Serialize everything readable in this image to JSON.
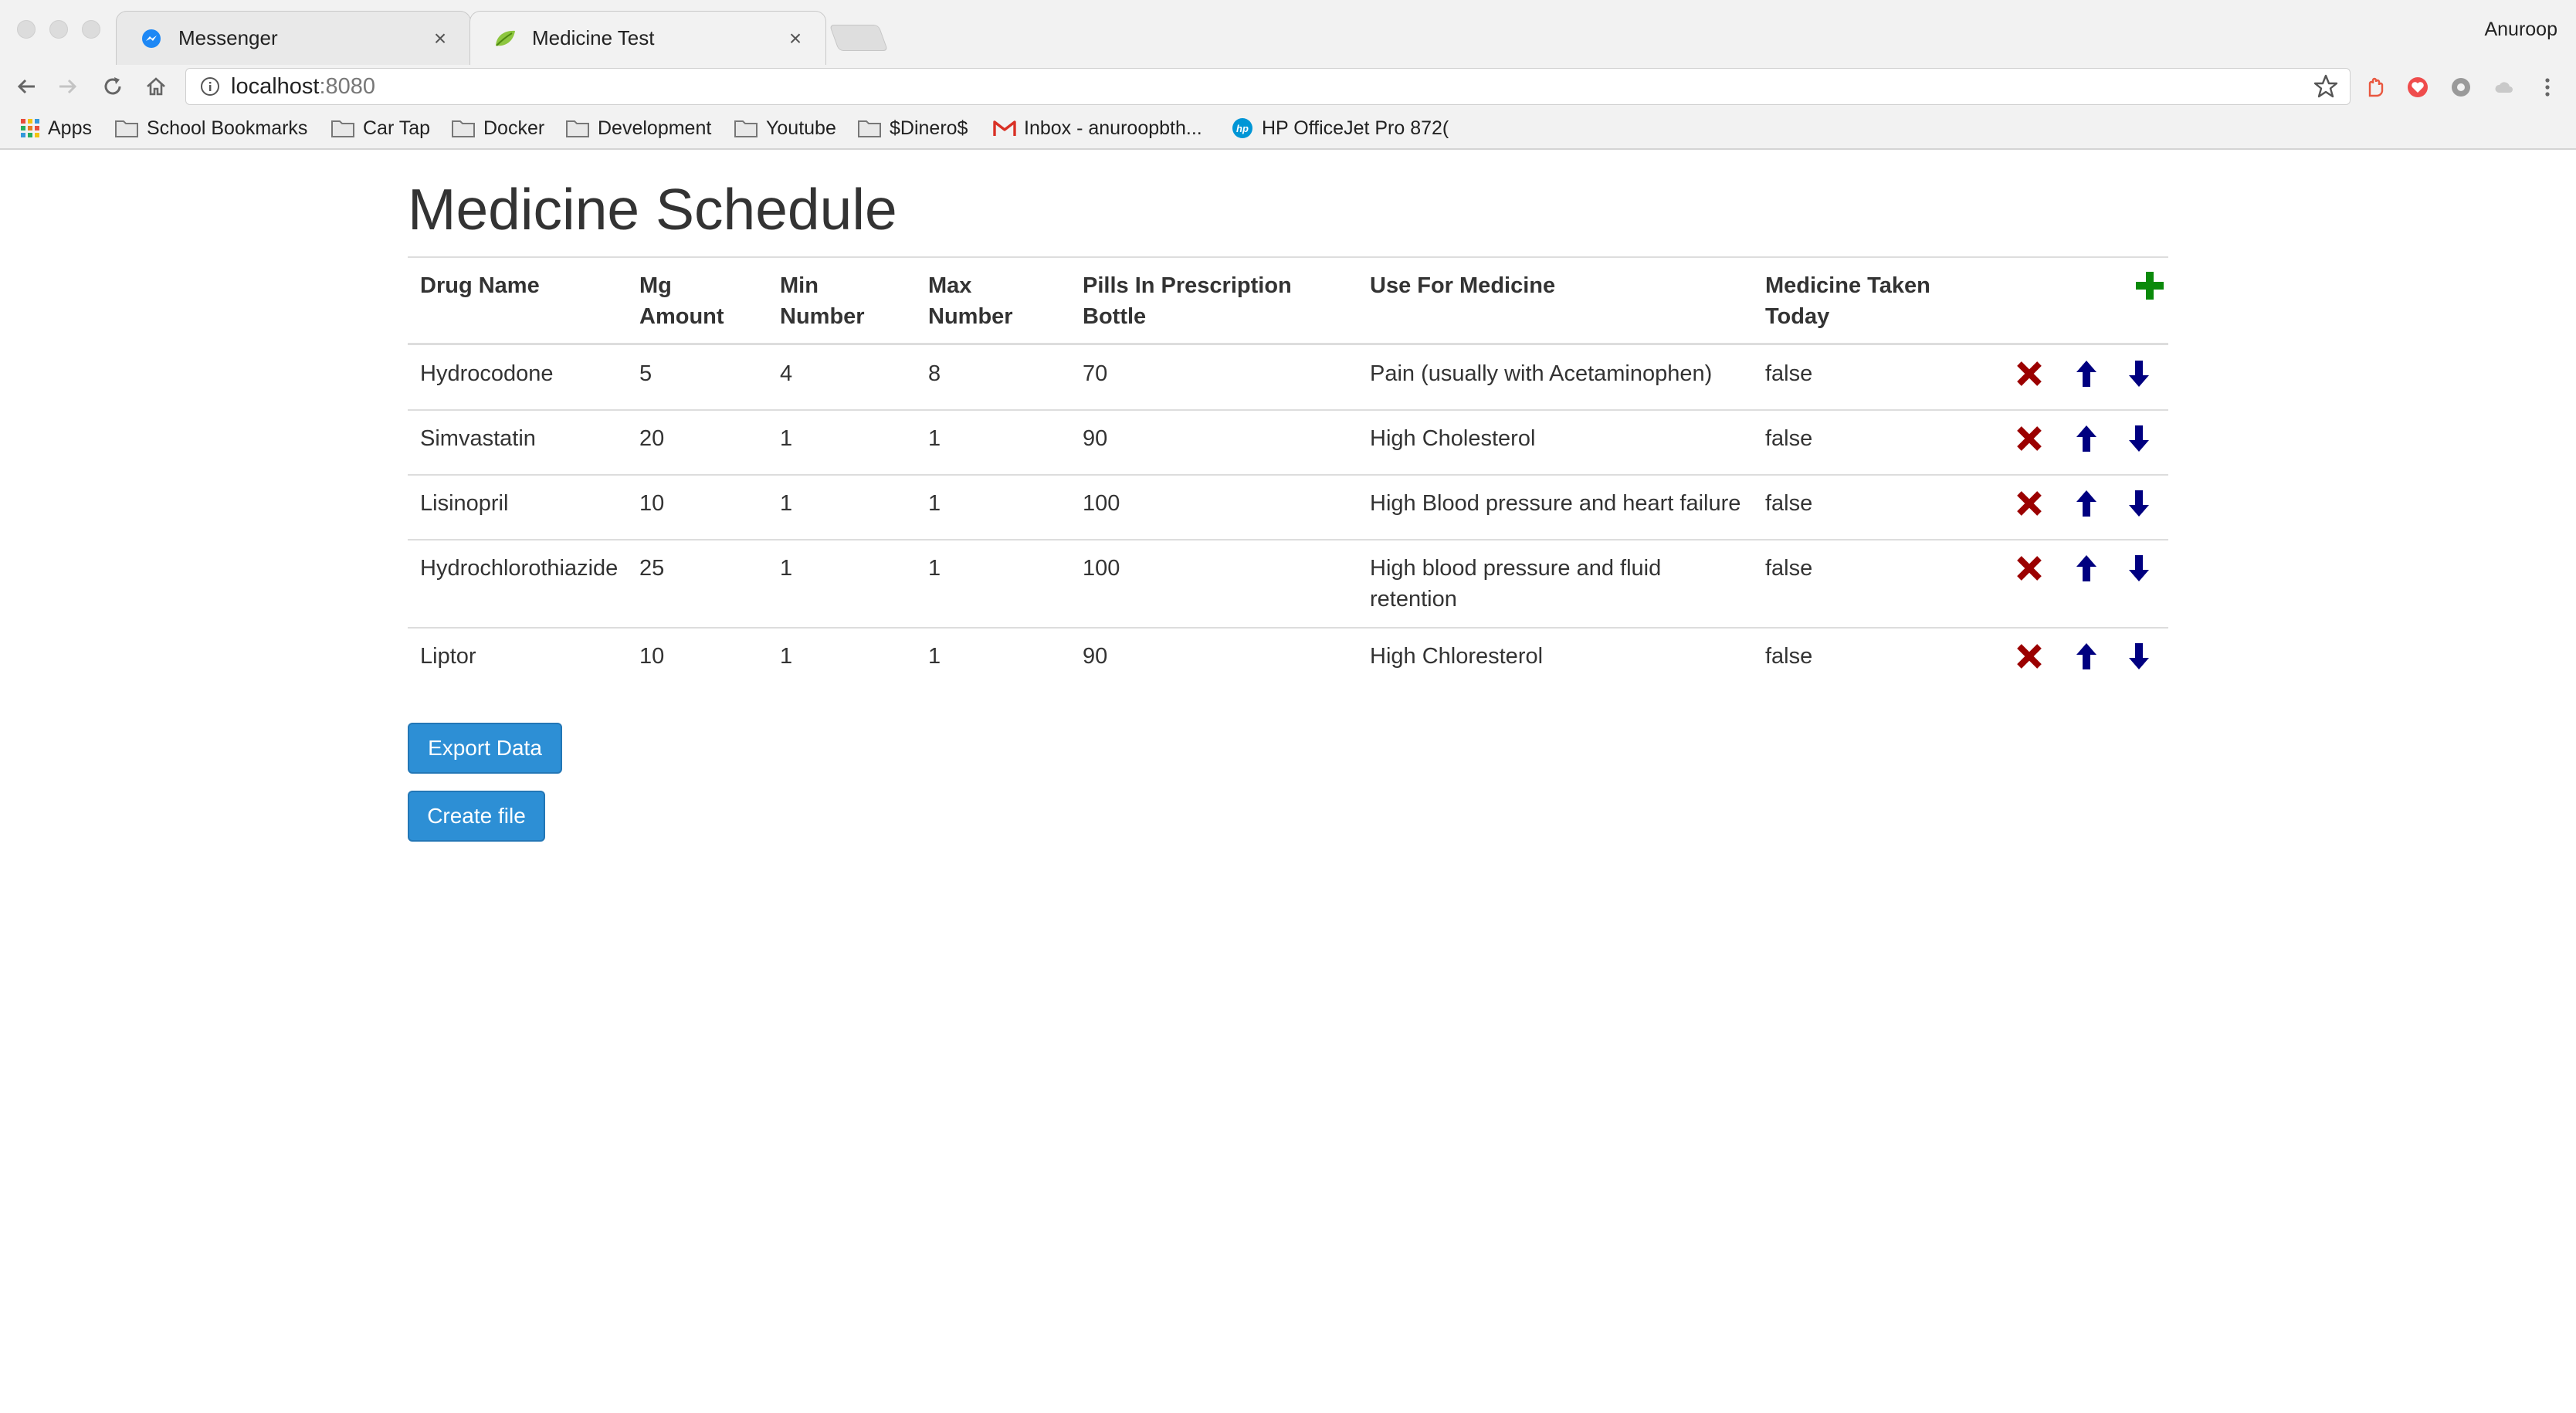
{
  "browser": {
    "tabs": [
      {
        "title": "Messenger",
        "active": false,
        "icon": "messenger-icon"
      },
      {
        "title": "Medicine Test",
        "active": true,
        "icon": "leaf-icon"
      }
    ],
    "profile_name": "Anuroop",
    "address": {
      "host": "localhost",
      "port": ":8080"
    },
    "bookmarks": [
      {
        "label": "Apps",
        "icon": "apps-grid-icon"
      },
      {
        "label": "School Bookmarks",
        "icon": "folder-icon"
      },
      {
        "label": "Car Tap",
        "icon": "folder-icon"
      },
      {
        "label": "Docker",
        "icon": "folder-icon"
      },
      {
        "label": "Development",
        "icon": "folder-icon"
      },
      {
        "label": "Youtube",
        "icon": "folder-icon"
      },
      {
        "label": "$Dinero$",
        "icon": "folder-icon"
      },
      {
        "label": "Inbox - anuroopbth...",
        "icon": "gmail-icon"
      },
      {
        "label": "HP OfficeJet Pro 872(",
        "icon": "hp-icon"
      }
    ]
  },
  "page": {
    "title": "Medicine Schedule",
    "columns": {
      "drug_name": "Drug Name",
      "mg_amount": [
        "Mg",
        "Amount"
      ],
      "min_number": [
        "Min",
        "Number"
      ],
      "max_number": [
        "Max",
        "Number"
      ],
      "pills": [
        "Pills In Prescription",
        "Bottle"
      ],
      "use": "Use For Medicine",
      "taken": [
        "Medicine Taken",
        "Today"
      ]
    },
    "rows": [
      {
        "drug": "Hydrocodone",
        "mg": "5",
        "min": "4",
        "max": "8",
        "pills": "70",
        "use": [
          "Pain (usually with Acetaminophen)"
        ],
        "taken": "false"
      },
      {
        "drug": "Simvastatin",
        "mg": "20",
        "min": "1",
        "max": "1",
        "pills": "90",
        "use": [
          "High Cholesterol"
        ],
        "taken": "false"
      },
      {
        "drug": "Lisinopril",
        "mg": "10",
        "min": "1",
        "max": "1",
        "pills": "100",
        "use": [
          "High Blood pressure and heart failure"
        ],
        "taken": "false"
      },
      {
        "drug": "Hydrochlorothiazide",
        "mg": "25",
        "min": "1",
        "max": "1",
        "pills": "100",
        "use": [
          "High blood pressure and fluid",
          "retention"
        ],
        "taken": "false"
      },
      {
        "drug": "Liptor",
        "mg": "10",
        "min": "1",
        "max": "1",
        "pills": "90",
        "use": [
          "High Chloresterol"
        ],
        "taken": "false"
      }
    ],
    "buttons": {
      "export": "Export Data",
      "create": "Create file"
    },
    "colors": {
      "add": "#0a8a0a",
      "delete": "#9b0000",
      "arrows": "#000080",
      "button": "#2d8fd5"
    }
  }
}
